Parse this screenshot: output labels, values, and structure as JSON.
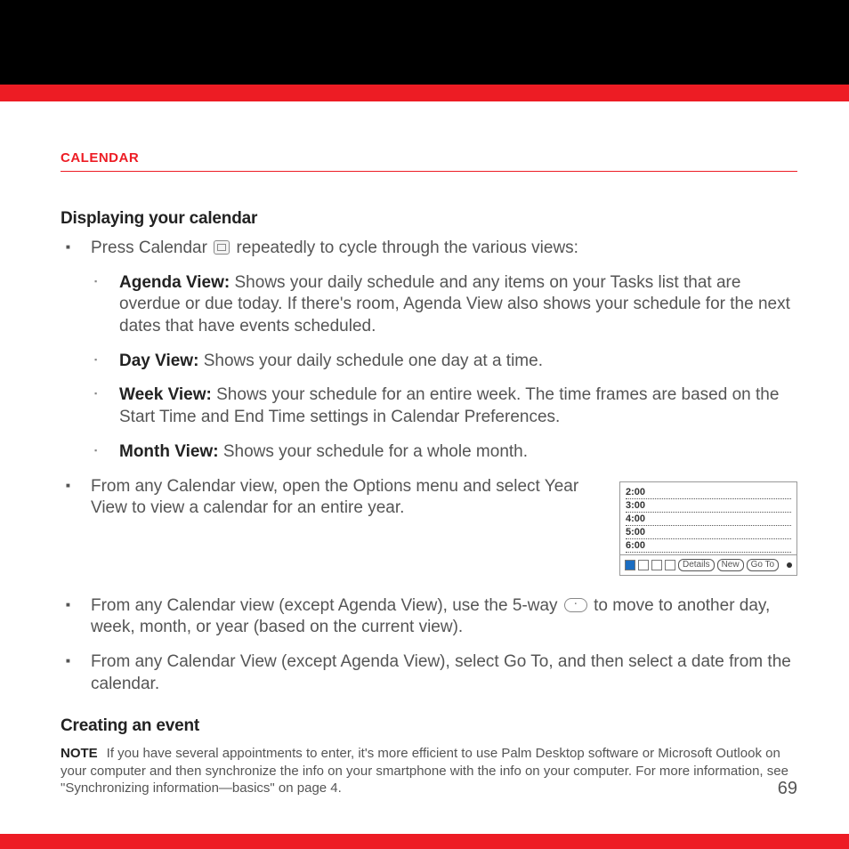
{
  "chapter": "CALENDAR",
  "section1": {
    "title": "Displaying your calendar",
    "press_before": "Press Calendar ",
    "press_after": " repeatedly to cycle through the various views:",
    "views": [
      {
        "name": "Agenda View:",
        "desc": " Shows your daily schedule and any items on your Tasks list that are overdue or due today. If there's room, Agenda View also shows your schedule for the next dates that have events scheduled."
      },
      {
        "name": "Day View:",
        "desc": " Shows your daily schedule one day at a time."
      },
      {
        "name": "Week View:",
        "desc": " Shows your schedule for an entire week. The time frames are based on the Start Time and End Time settings in Calendar Preferences."
      },
      {
        "name": "Month View:",
        "desc": " Shows your schedule for a whole month."
      }
    ],
    "bullets": [
      "From any Calendar view, open the Options menu and select Year View to view a calendar for an entire year.",
      "",
      "From any Calendar View (except Agenda View), select Go To, and then select a date from the calendar."
    ],
    "fiveway_before": "From any Calendar view (except Agenda View), use the 5-way ",
    "fiveway_after": " to move to another day, week, month, or year (based on the current view)."
  },
  "section2": {
    "title": "Creating an event",
    "note_label": "NOTE",
    "note_text": "If you have several appointments to enter, it's more efficient to use Palm Desktop software or Microsoft Outlook on your computer and then synchronize the info on your smartphone with the info on your computer. For more information, see \"Synchronizing information—basics\" on page 4."
  },
  "figure": {
    "times": [
      "2:00",
      "3:00",
      "4:00",
      "5:00",
      "6:00"
    ],
    "buttons": [
      "Details",
      "New",
      "Go To"
    ]
  },
  "page_number": "69"
}
